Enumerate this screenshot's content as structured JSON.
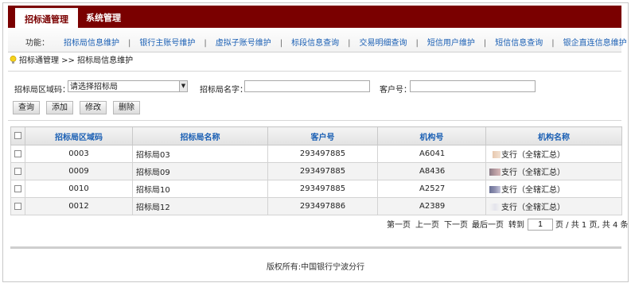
{
  "header": {
    "tabs": [
      {
        "label": "招标通管理",
        "active": true
      },
      {
        "label": "系统管理",
        "active": false
      }
    ],
    "brand_color": "#7a0000"
  },
  "function_bar": {
    "label": "功能：",
    "links": [
      "招标局信息维护",
      "银行主账号维护",
      "虚拟子账号维护",
      "标段信息查询",
      "交易明细查询",
      "短信用户维护",
      "短信信息查询",
      "银企直连信息维护"
    ]
  },
  "breadcrumb": "招标通管理 >> 招标局信息维护",
  "filters": {
    "region_label": "招标局区域码：",
    "region_value": "请选择招标局",
    "name_label": "招标局名字：",
    "name_value": "",
    "customer_label": "客户号：",
    "customer_value": ""
  },
  "buttons": {
    "query": "查询",
    "add": "添加",
    "edit": "修改",
    "delete": "删除"
  },
  "table": {
    "columns": [
      "招标局区域码",
      "招标局名称",
      "客户号",
      "机构号",
      "机构名称"
    ],
    "rows": [
      {
        "region": "0003",
        "name": "招标局03",
        "customer": "293497885",
        "org": "A6041",
        "org_name": "支行（全辖汇总）"
      },
      {
        "region": "0009",
        "name": "招标局09",
        "customer": "293497885",
        "org": "A8436",
        "org_name": "支行（全辖汇总）"
      },
      {
        "region": "0010",
        "name": "招标局10",
        "customer": "293497885",
        "org": "A2527",
        "org_name": "支行（全辖汇总）"
      },
      {
        "region": "0012",
        "name": "招标局12",
        "customer": "293497886",
        "org": "A2389",
        "org_name": "支行（全辖汇总）"
      }
    ]
  },
  "pager": {
    "first": "第一页",
    "prev": "上一页",
    "next": "下一页",
    "last": "最后一页",
    "goto": "转到",
    "page_value": "1",
    "summary": "页 / 共 1 页, 共 4 条"
  },
  "footer": "版权所有:中国银行宁波分行"
}
